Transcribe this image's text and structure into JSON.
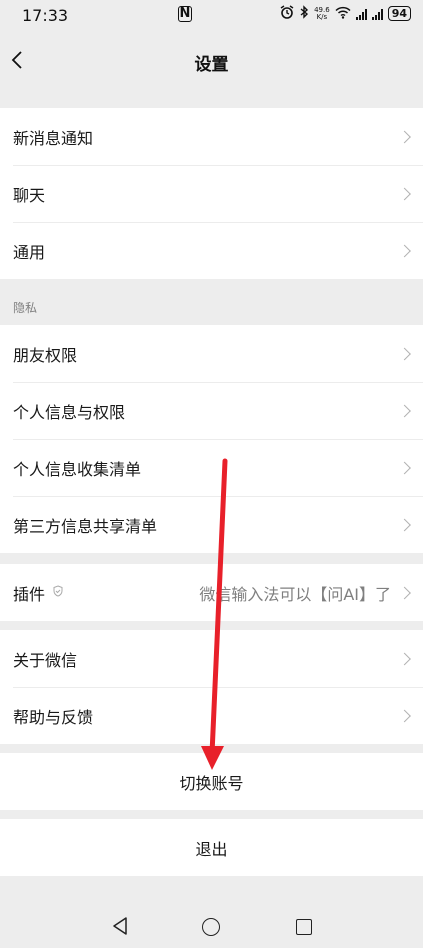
{
  "status": {
    "time": "17:33",
    "nfc": "N",
    "speed_top": "49.6",
    "speed_unit": "K/s",
    "battery": "94"
  },
  "header": {
    "title": "设置"
  },
  "group1": [
    {
      "label": "新消息通知"
    },
    {
      "label": "聊天"
    },
    {
      "label": "通用"
    }
  ],
  "privacy": {
    "section_label": "隐私",
    "items": [
      {
        "label": "朋友权限"
      },
      {
        "label": "个人信息与权限"
      },
      {
        "label": "个人信息收集清单"
      },
      {
        "label": "第三方信息共享清单"
      }
    ]
  },
  "plugin": {
    "label": "插件",
    "value": "微信输入法可以【问AI】了"
  },
  "group4": [
    {
      "label": "关于微信"
    },
    {
      "label": "帮助与反馈"
    }
  ],
  "actions": {
    "switch_account": "切换账号",
    "logout": "退出"
  },
  "annotation": {
    "arrow_color": "#e8202a"
  }
}
